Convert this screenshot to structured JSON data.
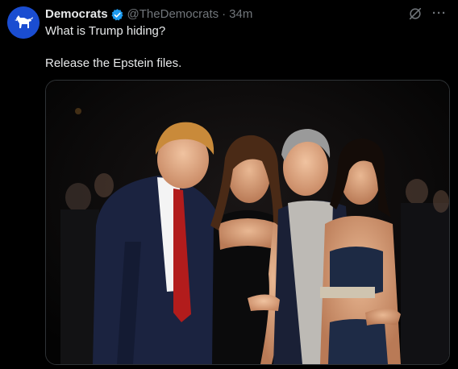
{
  "author": {
    "display_name": "Democrats",
    "handle": "@TheDemocrats",
    "separator": "·",
    "timestamp": "34m",
    "verified_badge": "blue-check-icon",
    "avatar_icon": "donkey-logo-icon",
    "avatar_color": "#1a4dd1"
  },
  "tweet": {
    "line1": "What is Trump hiding?",
    "line2": "Release the Epstein files."
  },
  "actions": {
    "grok_icon": "grok-icon",
    "more_icon": "more-options-icon",
    "more_glyph": "···"
  },
  "media": {
    "type": "photo",
    "subject_icon": "photo-of-four-people"
  },
  "colors": {
    "background": "#000000",
    "primary_text": "#e7e9ea",
    "secondary_text": "#71767b",
    "verified": "#1d9bf0",
    "border": "#2f3336"
  }
}
